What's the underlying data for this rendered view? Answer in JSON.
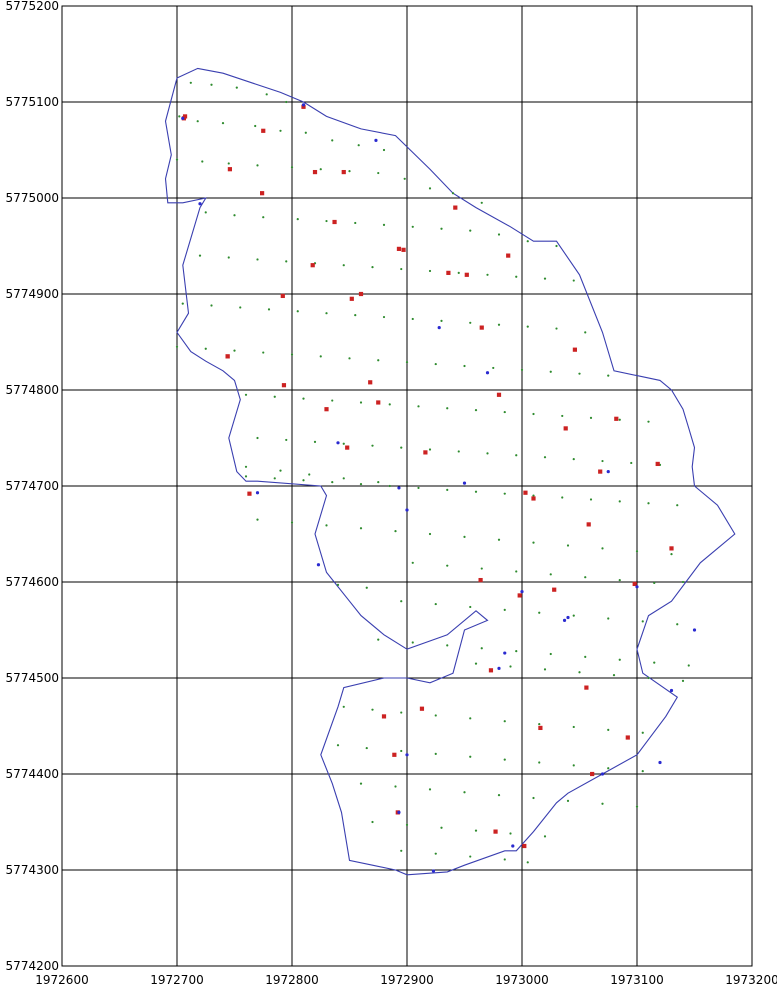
{
  "chart_data": {
    "type": "scatter",
    "title": "",
    "xlabel": "",
    "ylabel": "",
    "xlim": [
      1972600,
      1973200
    ],
    "ylim": [
      5774200,
      5775200
    ],
    "grid": true,
    "x_ticks": [
      1972600,
      1972700,
      1972800,
      1972900,
      1973000,
      1973100,
      1973200
    ],
    "y_ticks": [
      5774200,
      5774300,
      5774400,
      5774500,
      5774600,
      5774700,
      5774800,
      5774900,
      5775000,
      5775100,
      5775200
    ],
    "x_tick_labels": [
      "1972600",
      "1972700",
      "1972800",
      "1972900",
      "1973000",
      "1973100",
      "1973200"
    ],
    "y_tick_labels": [
      "5774200",
      "5774300",
      "5774400",
      "5774500",
      "5774600",
      "5774700",
      "5774800",
      "5774900",
      "5775000",
      "5775100",
      "5775200"
    ],
    "boundary": {
      "color": "#3a3fb0",
      "x": [
        1972718,
        1972740,
        1972765,
        1972790,
        1972810,
        1972830,
        1972860,
        1972890,
        1972920,
        1972940,
        1972960,
        1972990,
        1973010,
        1973030,
        1973050,
        1973070,
        1973080,
        1973100,
        1973120,
        1973130,
        1973140,
        1973145,
        1973150,
        1973148,
        1973150,
        1973170,
        1973185,
        1973155,
        1973130,
        1973110,
        1973100,
        1973105,
        1973135,
        1973125,
        1973100,
        1973070,
        1973040,
        1973030,
        1973010,
        1972995,
        1972985,
        1972950,
        1972935,
        1972900,
        1972890,
        1972870,
        1972850,
        1972843,
        1972835,
        1972825,
        1972840,
        1972845,
        1972880,
        1972900,
        1972920,
        1972940,
        1972950,
        1972970,
        1972960,
        1972935,
        1972900,
        1972880,
        1972860,
        1972850,
        1972830,
        1972820,
        1972830,
        1972825,
        1972770,
        1972760,
        1972752,
        1972745,
        1972755,
        1972750,
        1972740,
        1972725,
        1972712,
        1972700,
        1972710,
        1972705,
        1972720,
        1972725,
        1972705,
        1972692,
        1972690,
        1972695,
        1972690,
        1972700,
        1972718
      ],
      "y": [
        5775135,
        5775130,
        5775120,
        5775110,
        5775100,
        5775085,
        5775072,
        5775065,
        5775030,
        5775005,
        5774990,
        5774970,
        5774955,
        5774955,
        5774920,
        5774860,
        5774820,
        5774815,
        5774810,
        5774800,
        5774780,
        5774760,
        5774740,
        5774720,
        5774700,
        5774680,
        5774650,
        5774620,
        5774580,
        5774565,
        5774530,
        5774505,
        5774480,
        5774460,
        5774420,
        5774400,
        5774380,
        5774370,
        5774340,
        5774320,
        5774320,
        5774305,
        5774298,
        5774295,
        5774300,
        5774305,
        5774310,
        5774360,
        5774390,
        5774420,
        5774470,
        5774490,
        5774500,
        5774500,
        5774495,
        5774505,
        5774550,
        5774560,
        5774570,
        5774545,
        5774530,
        5774545,
        5774565,
        5774580,
        5774610,
        5774650,
        5774690,
        5774700,
        5774705,
        5774705,
        5774715,
        5774750,
        5774790,
        5774810,
        5774820,
        5774830,
        5774840,
        5774860,
        5774880,
        5774930,
        5774990,
        5775000,
        5774995,
        5774995,
        5775020,
        5775045,
        5775080,
        5775125,
        5775135
      ]
    },
    "series": [
      {
        "color": "#2e8b2e",
        "x": [
          1972712,
          1972730,
          1972752,
          1972778,
          1972795,
          1972702,
          1972718,
          1972740,
          1972768,
          1972790,
          1972812,
          1972835,
          1972858,
          1972880,
          1972700,
          1972722,
          1972745,
          1972770,
          1972800,
          1972825,
          1972850,
          1972875,
          1972898,
          1972920,
          1972940,
          1972965,
          1972725,
          1972750,
          1972775,
          1972805,
          1972830,
          1972855,
          1972880,
          1972905,
          1972930,
          1972955,
          1972980,
          1973005,
          1973030,
          1972720,
          1972745,
          1972770,
          1972795,
          1972820,
          1972845,
          1972870,
          1972895,
          1972920,
          1972945,
          1972970,
          1972995,
          1973020,
          1973045,
          1972705,
          1972730,
          1972755,
          1972780,
          1972805,
          1972830,
          1972855,
          1972880,
          1972905,
          1972930,
          1972955,
          1972980,
          1973005,
          1973030,
          1973055,
          1972700,
          1972725,
          1972750,
          1972775,
          1972800,
          1972825,
          1972850,
          1972875,
          1972900,
          1972925,
          1972950,
          1972975,
          1973000,
          1973025,
          1973050,
          1973075,
          1972760,
          1972785,
          1972810,
          1972835,
          1972860,
          1972885,
          1972910,
          1972935,
          1972960,
          1972985,
          1973010,
          1973035,
          1973060,
          1973085,
          1973110,
          1972770,
          1972795,
          1972820,
          1972845,
          1972870,
          1972895,
          1972920,
          1972945,
          1972970,
          1972995,
          1973020,
          1973045,
          1973070,
          1973095,
          1973120,
          1972760,
          1972785,
          1972810,
          1972835,
          1972860,
          1972885,
          1972910,
          1972935,
          1972960,
          1972985,
          1973010,
          1973035,
          1973060,
          1973085,
          1973110,
          1973135,
          1972770,
          1972800,
          1972830,
          1972860,
          1972890,
          1972920,
          1972950,
          1972980,
          1973010,
          1973040,
          1973070,
          1973100,
          1973130,
          1972760,
          1972790,
          1972815,
          1972845,
          1972875,
          1972905,
          1972935,
          1972965,
          1972995,
          1973025,
          1973055,
          1973085,
          1973115,
          1973140,
          1972840,
          1972865,
          1972895,
          1972925,
          1972955,
          1972985,
          1973015,
          1973045,
          1973075,
          1973105,
          1973135,
          1972875,
          1972905,
          1972935,
          1972965,
          1972995,
          1973025,
          1973055,
          1973085,
          1973115,
          1973145,
          1972960,
          1972990,
          1973020,
          1973050,
          1973080,
          1973110,
          1973140,
          1972845,
          1972870,
          1972895,
          1972925,
          1972955,
          1972985,
          1973015,
          1973045,
          1973075,
          1973105,
          1972840,
          1972865,
          1972895,
          1972925,
          1972955,
          1972985,
          1973015,
          1973045,
          1973075,
          1973105,
          1972860,
          1972890,
          1972920,
          1972950,
          1972980,
          1973010,
          1973040,
          1973070,
          1973100,
          1972870,
          1972900,
          1972930,
          1972960,
          1972990,
          1973020,
          1972895,
          1972925,
          1972955,
          1972985,
          1973005
        ],
        "y": [
          5775120,
          5775118,
          5775115,
          5775108,
          5775100,
          5775085,
          5775080,
          5775078,
          5775075,
          5775070,
          5775068,
          5775060,
          5775055,
          5775050,
          5775040,
          5775038,
          5775036,
          5775034,
          5775032,
          5775030,
          5775028,
          5775026,
          5775020,
          5775010,
          5775005,
          5774995,
          5774985,
          5774982,
          5774980,
          5774978,
          5774976,
          5774974,
          5774972,
          5774970,
          5774968,
          5774966,
          5774962,
          5774955,
          5774950,
          5774940,
          5774938,
          5774936,
          5774934,
          5774932,
          5774930,
          5774928,
          5774926,
          5774924,
          5774922,
          5774920,
          5774918,
          5774916,
          5774914,
          5774890,
          5774888,
          5774886,
          5774884,
          5774882,
          5774880,
          5774878,
          5774876,
          5774874,
          5774872,
          5774870,
          5774868,
          5774866,
          5774864,
          5774860,
          5774845,
          5774843,
          5774841,
          5774839,
          5774837,
          5774835,
          5774833,
          5774831,
          5774829,
          5774827,
          5774825,
          5774823,
          5774821,
          5774819,
          5774817,
          5774815,
          5774795,
          5774793,
          5774791,
          5774789,
          5774787,
          5774785,
          5774783,
          5774781,
          5774779,
          5774777,
          5774775,
          5774773,
          5774771,
          5774769,
          5774767,
          5774750,
          5774748,
          5774746,
          5774744,
          5774742,
          5774740,
          5774738,
          5774736,
          5774734,
          5774732,
          5774730,
          5774728,
          5774726,
          5774724,
          5774722,
          5774710,
          5774708,
          5774706,
          5774704,
          5774702,
          5774700,
          5774698,
          5774696,
          5774694,
          5774692,
          5774690,
          5774688,
          5774686,
          5774684,
          5774682,
          5774680,
          5774665,
          5774662,
          5774659,
          5774656,
          5774653,
          5774650,
          5774647,
          5774644,
          5774641,
          5774638,
          5774635,
          5774632,
          5774629,
          5774720,
          5774716,
          5774712,
          5774708,
          5774704,
          5774620,
          5774617,
          5774614,
          5774611,
          5774608,
          5774605,
          5774602,
          5774599,
          5774600,
          5774597,
          5774594,
          5774580,
          5774577,
          5774574,
          5774571,
          5774568,
          5774565,
          5774562,
          5774559,
          5774556,
          5774540,
          5774537,
          5774534,
          5774531,
          5774528,
          5774525,
          5774522,
          5774519,
          5774516,
          5774513,
          5774515,
          5774512,
          5774509,
          5774506,
          5774503,
          5774500,
          5774497,
          5774470,
          5774467,
          5774464,
          5774461,
          5774458,
          5774455,
          5774452,
          5774449,
          5774446,
          5774443,
          5774430,
          5774427,
          5774424,
          5774421,
          5774418,
          5774415,
          5774412,
          5774409,
          5774406,
          5774403,
          5774390,
          5774387,
          5774384,
          5774381,
          5774378,
          5774375,
          5774372,
          5774369,
          5774366,
          5774350,
          5774347,
          5774344,
          5774341,
          5774338,
          5774335,
          5774320,
          5774317,
          5774314,
          5774311,
          5774308
        ]
      },
      {
        "color": "#cc2222",
        "x": [
          1972707,
          1972775,
          1972820,
          1972845,
          1972860,
          1972875,
          1972942,
          1972952,
          1972965,
          1972988,
          1973010,
          1973028,
          1973038,
          1973046,
          1973058,
          1973082,
          1973098,
          1973130,
          1973118,
          1972706,
          1972746,
          1972792,
          1972848,
          1972868,
          1972893,
          1972936,
          1972964,
          1972998,
          1973016,
          1973056,
          1972763,
          1972818,
          1972852,
          1972880,
          1972916,
          1972973,
          1973002,
          1972774,
          1972793,
          1972837,
          1972913,
          1972980,
          1973068,
          1973092,
          1972810,
          1972892,
          1972977,
          1972744,
          1972830,
          1972889,
          1973061,
          1972744,
          1972897,
          1973003
        ],
        "y": [
          5775085,
          5775070,
          5775027,
          5775027,
          5774900,
          5774787,
          5774990,
          5774920,
          5774865,
          5774940,
          5774687,
          5774592,
          5774760,
          5774842,
          5774660,
          5774770,
          5774598,
          5774635,
          5774723,
          5775083,
          5775030,
          5774898,
          5774740,
          5774808,
          5774947,
          5774922,
          5774602,
          5774586,
          5774448,
          5774490,
          5774692,
          5774930,
          5774895,
          5774460,
          5774735,
          5774508,
          5774325,
          5775005,
          5774805,
          5774975,
          5774468,
          5774795,
          5774715,
          5774438,
          5775095,
          5774360,
          5774340,
          5774835,
          5774780,
          5774420,
          5774400,
          5774835,
          5774946,
          5774693
        ]
      },
      {
        "color": "#2a2ad0",
        "x": [
          1972705,
          1972720,
          1972810,
          1972873,
          1972900,
          1972923,
          1972950,
          1972970,
          1972980,
          1973000,
          1973040,
          1973070,
          1973100,
          1973120,
          1973150,
          1973130,
          1972823,
          1972893,
          1972928,
          1972985,
          1972770,
          1972840,
          1972893,
          1973037,
          1973075,
          1972900,
          1972992
        ],
        "y": [
          5775083,
          5774994,
          5775097,
          5775060,
          5774675,
          5774299,
          5774703,
          5774818,
          5774510,
          5774590,
          5774563,
          5774400,
          5774595,
          5774412,
          5774550,
          5774487,
          5774618,
          5774698,
          5774865,
          5774526,
          5774693,
          5774745,
          5774360,
          5774560,
          5774715,
          5774420,
          5774325
        ]
      }
    ]
  }
}
